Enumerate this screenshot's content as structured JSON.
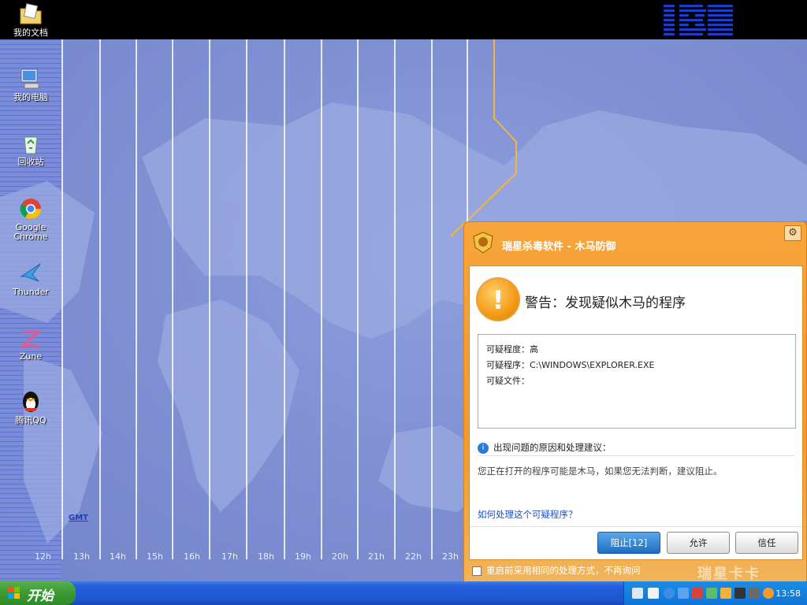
{
  "desktop": {
    "icons": [
      {
        "label": "我的文档",
        "icon": "folder-documents-icon"
      },
      {
        "label": "我的电脑",
        "icon": "computer-icon"
      },
      {
        "label": "回收站",
        "icon": "recycle-bin-icon"
      },
      {
        "label_line1": "Google",
        "label_line2": "Chrome",
        "icon": "chrome-icon"
      },
      {
        "label": "Thunder",
        "icon": "thunder-icon"
      },
      {
        "label": "Zune",
        "icon": "zune-icon"
      },
      {
        "label": "腾讯QQ",
        "icon": "qq-penguin-icon"
      }
    ],
    "map": {
      "gmt_label": "GMT",
      "hours": [
        "12h",
        "13h",
        "14h",
        "15h",
        "16h",
        "17h",
        "18h",
        "19h",
        "20h",
        "21h",
        "22h",
        "23h"
      ]
    }
  },
  "dialog": {
    "title": "瑞星杀毒软件 - 木马防御",
    "warning_title": "警告：发现疑似木马的程序",
    "info": {
      "level": "可疑程度：高",
      "program": "可疑程序：C:\\WINDOWS\\EXPLORER.EXE",
      "file": "可疑文件："
    },
    "reason_header": "出现问题的原因和处理建议：",
    "reason_text": "您正在打开的程序可能是木马，如果您无法判断，建议阻止。",
    "help_link": "如何处理这个可疑程序？",
    "buttons": {
      "block": "阻止[12]",
      "allow": "允许",
      "trust": "信任"
    },
    "remember_label": "重启前采用相同的处理方式，不再询问",
    "watermark": "瑞星卡卡"
  },
  "taskbar": {
    "start_label": "开始",
    "clock": "13:58"
  },
  "colors": {
    "dialog_orange": "#f39a2c",
    "primary_button": "#1f6dc2",
    "taskbar_blue": "#245edb",
    "start_green": "#3a9a31"
  }
}
